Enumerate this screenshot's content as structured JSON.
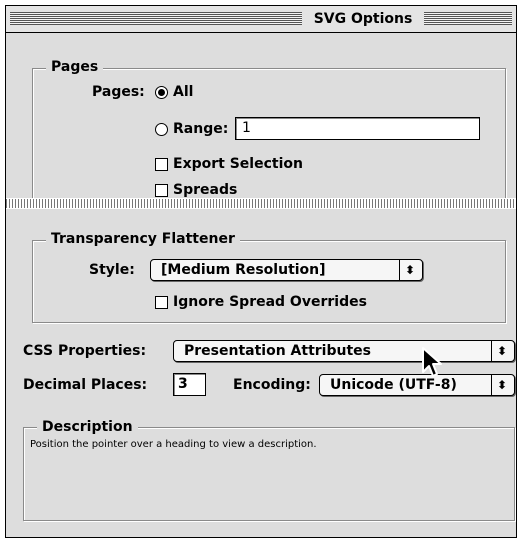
{
  "window": {
    "title": "SVG Options"
  },
  "pages": {
    "legend": "Pages",
    "pages_label": "Pages:",
    "all_label": "All",
    "range_label": "Range:",
    "range_value": "1",
    "export_selection_label": "Export Selection",
    "spreads_label": "Spreads",
    "selected_option": "All",
    "export_selection_checked": false,
    "spreads_checked": false
  },
  "transparency": {
    "legend": "Transparency Flattener",
    "style_label": "Style:",
    "style_value": "[Medium Resolution]",
    "ignore_overrides_label": "Ignore Spread Overrides",
    "ignore_overrides_checked": false
  },
  "css": {
    "label": "CSS Properties:",
    "value": "Presentation Attributes"
  },
  "decimal": {
    "label": "Decimal Places:",
    "value": "3"
  },
  "encoding": {
    "label": "Encoding:",
    "value": "Unicode (UTF-8)"
  },
  "description": {
    "legend": "Description",
    "text": "Position the pointer over a heading to view a description."
  },
  "icons": {
    "popup_arrows": "up-down-arrows-icon",
    "cursor": "mouse-pointer-icon"
  }
}
